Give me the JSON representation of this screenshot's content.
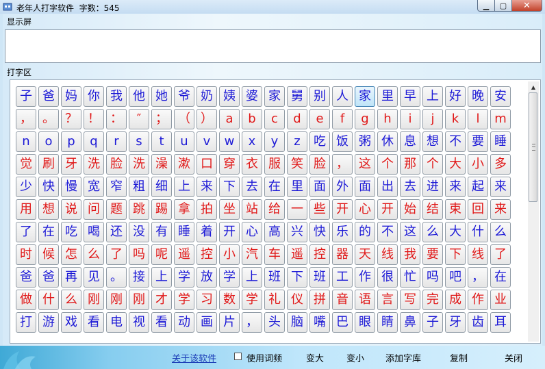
{
  "window": {
    "title": "老年人打字软件  字数：545",
    "minimize_icon": "minimize-icon",
    "maximize_icon": "maximize-icon",
    "close_icon": "close-icon"
  },
  "display": {
    "label": "显示屏",
    "value": ""
  },
  "keyboard": {
    "label": "打字区",
    "colors": {
      "blue": "#1d1ad6",
      "red": "#e01818",
      "highlight": "#bfe4f8"
    },
    "rows": [
      {
        "color": "blue",
        "keys": [
          "子",
          "爸",
          "妈",
          "你",
          "我",
          "他",
          "她",
          "爷",
          "奶",
          "姨",
          "婆",
          "家",
          "舅",
          "别",
          "人",
          "家",
          "里",
          "早",
          "上",
          "好",
          "晚",
          "安"
        ]
      },
      {
        "color": "red",
        "keys": [
          "，",
          "。",
          "？",
          "！",
          "：",
          "″",
          "；",
          "（",
          "）",
          "a",
          "b",
          "c",
          "d",
          "e",
          "f",
          "g",
          "h",
          "i",
          "j",
          "k",
          "l",
          "m"
        ]
      },
      {
        "color": "blue",
        "keys": [
          "n",
          "o",
          "p",
          "q",
          "r",
          "s",
          "t",
          "u",
          "v",
          "w",
          "x",
          "y",
          "z",
          "吃",
          "饭",
          "粥",
          "休",
          "息",
          "想",
          "不",
          "要",
          "睡"
        ]
      },
      {
        "color": "red",
        "keys": [
          "觉",
          "刷",
          "牙",
          "洗",
          "脸",
          "洗",
          "澡",
          "漱",
          "口",
          "穿",
          "衣",
          "服",
          "笑",
          "脸",
          "，",
          "这",
          "个",
          "那",
          "个",
          "大",
          "小",
          "多"
        ]
      },
      {
        "color": "blue",
        "keys": [
          "少",
          "快",
          "慢",
          "宽",
          "窄",
          "粗",
          "细",
          "上",
          "来",
          "下",
          "去",
          "在",
          "里",
          "面",
          "外",
          "面",
          "出",
          "去",
          "进",
          "来",
          "起",
          "来"
        ]
      },
      {
        "color": "red",
        "keys": [
          "用",
          "想",
          "说",
          "问",
          "题",
          "跳",
          "踢",
          "拿",
          "拍",
          "坐",
          "站",
          "给",
          "一",
          "些",
          "开",
          "心",
          "开",
          "始",
          "结",
          "束",
          "回",
          "来"
        ]
      },
      {
        "color": "blue",
        "keys": [
          "了",
          "在",
          "吃",
          "喝",
          "还",
          "没",
          "有",
          "睡",
          "着",
          "开",
          "心",
          "高",
          "兴",
          "快",
          "乐",
          "的",
          "不",
          "这",
          "么",
          "大",
          "什",
          "么"
        ]
      },
      {
        "color": "red",
        "keys": [
          "时",
          "候",
          "怎",
          "么",
          "了",
          "吗",
          "呢",
          "遥",
          "控",
          "小",
          "汽",
          "车",
          "遥",
          "控",
          "器",
          "天",
          "线",
          "我",
          "要",
          "下",
          "线",
          "了"
        ]
      },
      {
        "color": "blue",
        "keys": [
          "爸",
          "爸",
          "再",
          "见",
          "。",
          "接",
          "上",
          "学",
          "放",
          "学",
          "上",
          "班",
          "下",
          "班",
          "工",
          "作",
          "很",
          "忙",
          "吗",
          "吧",
          "，",
          "在"
        ]
      },
      {
        "color": "red",
        "keys": [
          "做",
          "什",
          "么",
          "刚",
          "刚",
          "刚",
          "才",
          "学",
          "习",
          "数",
          "学",
          "礼",
          "仪",
          "拼",
          "音",
          "语",
          "言",
          "写",
          "完",
          "成",
          "作",
          "业"
        ]
      },
      {
        "color": "blue",
        "keys": [
          "打",
          "游",
          "戏",
          "看",
          "电",
          "视",
          "看",
          "动",
          "画",
          "片",
          "，",
          "头",
          "脑",
          "嘴",
          "巴",
          "眼",
          "睛",
          "鼻",
          "子",
          "牙",
          "齿",
          "耳"
        ]
      }
    ],
    "highlighted": {
      "row": 0,
      "col": 15
    },
    "scrollbar": {
      "up_icon": "scroll-up-arrow-icon"
    }
  },
  "bottom": {
    "about": "关于该软件",
    "word_freq": {
      "label": "使用词频",
      "checked": false
    },
    "bigger": "变大",
    "smaller": "变小",
    "add_dict": "添加字库",
    "copy": "复制",
    "close": "关闭"
  }
}
